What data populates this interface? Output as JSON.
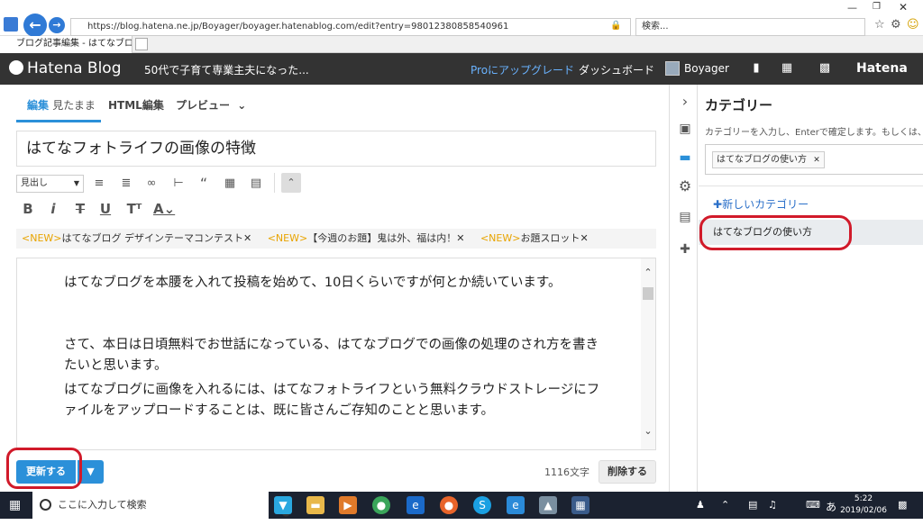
{
  "browser": {
    "url": "https://blog.hatena.ne.jp/Boyager/boyager.hatenablog.com/edit?entry=98012380858540961",
    "search_placeholder": "検索...",
    "tab_title": "ブログ記事編集 - はてなブログ"
  },
  "header": {
    "logo": "Hatena Blog",
    "blog_title": "50代で子育て専業主夫になった...",
    "pro_link": "Proにアップグレード",
    "dashboard": "ダッシュボード",
    "user": "Boyager",
    "brand": "Hatena"
  },
  "editor": {
    "tabs": {
      "edit": "編集",
      "edit_sub": "見たまま",
      "html": "HTML編集",
      "preview": "プレビュー"
    },
    "title": "はてなフォトライフの画像の特徴",
    "heading_select": "見出し",
    "news": [
      {
        "tag": "<NEW>",
        "text": "はてなブログ デザインテーマコンテスト"
      },
      {
        "tag": "<NEW>",
        "text": "【今週のお題】鬼は外、福は内！"
      },
      {
        "tag": "<NEW>",
        "text": "お題スロット"
      }
    ],
    "body": [
      "はてなブログを本腰を入れて投稿を始めて、10日くらいですが何とか続いています。",
      "さて、本日は日頃無料でお世話になっている、はてなブログでの画像の処理のされ方を書きたいと思います。",
      "はてなブログに画像を入れるには、はてなフォトライフという無料クラウドストレージにファイルをアップロードすることは、既に皆さんご存知のことと思います。"
    ],
    "update_button": "更新する",
    "char_count": "1116文字",
    "delete_button": "削除する"
  },
  "category": {
    "title": "カテゴリー",
    "hint": "カテゴリーを入力し、Enterで確定します。もしくは、",
    "tag": "はてなブログの使い方",
    "new_category": "新しいカテゴリー",
    "item": "はてなブログの使い方"
  },
  "taskbar": {
    "search": "ここに入力して検索",
    "time": "5:22",
    "date": "2019/02/06"
  },
  "colors": {
    "accent": "#2b90d9",
    "header_bg": "#333333",
    "highlight_circle": "#d11a2a",
    "news_tag": "#e8a400"
  }
}
